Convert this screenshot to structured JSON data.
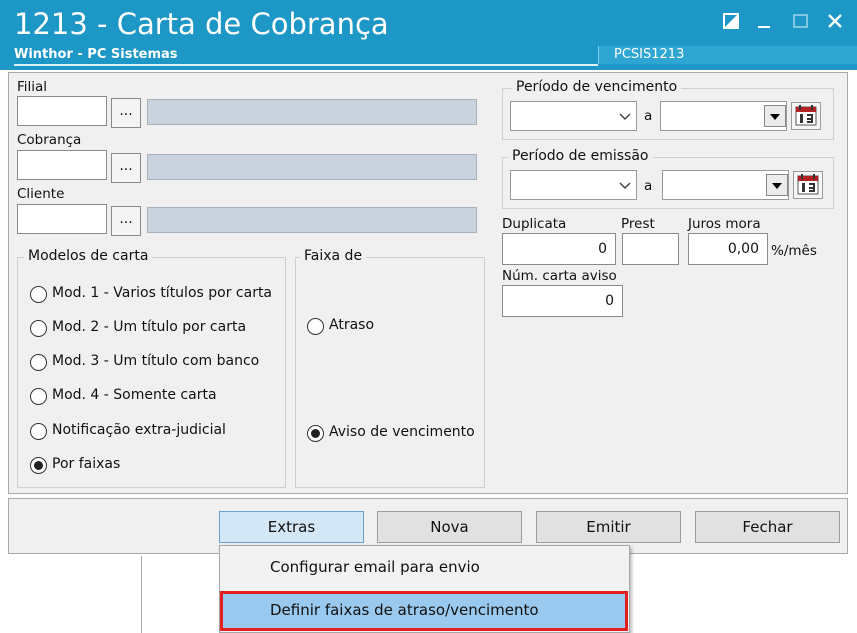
{
  "window": {
    "title": "1213 - Carta de Cobrança",
    "subtitle": "Winthor - PC Sistemas",
    "code": "PCSIS1213"
  },
  "filters": {
    "filial_label": "Filial",
    "cobranca_label": "Cobrança",
    "cliente_label": "Cliente",
    "lookup_button": "..."
  },
  "modelos": {
    "title": "Modelos de carta",
    "options": [
      {
        "label": "Mod. 1 - Varios títulos por carta",
        "selected": false
      },
      {
        "label": "Mod. 2 - Um título por carta",
        "selected": false
      },
      {
        "label": "Mod. 3 - Um título com banco",
        "selected": false
      },
      {
        "label": "Mod. 4 - Somente carta",
        "selected": false
      },
      {
        "label": "Notificação extra-judicial",
        "selected": false
      },
      {
        "label": "Por faixas",
        "selected": true
      }
    ]
  },
  "faixa": {
    "title": "Faixa de",
    "options": [
      {
        "label": "Atraso",
        "selected": false
      },
      {
        "label": "Aviso de vencimento",
        "selected": true
      }
    ]
  },
  "periodo_vencimento": {
    "title": "Período de vencimento",
    "separator": "a"
  },
  "periodo_emissao": {
    "title": "Período de emissão",
    "separator": "a"
  },
  "fields": {
    "duplicata_label": "Duplicata",
    "duplicata_value": "0",
    "prest_label": "Prest",
    "prest_value": "",
    "juros_label": "Juros mora",
    "juros_value": "0,00",
    "juros_unit": "%/mês",
    "num_carta_label": "Núm. carta aviso",
    "num_carta_value": "0"
  },
  "buttons": {
    "extras": "Extras",
    "nova": "Nova",
    "emitir": "Emitir",
    "fechar": "Fechar"
  },
  "menu": {
    "items": [
      "Configurar email para envio",
      "Definir faixas de atraso/vencimento"
    ],
    "highlighted": 1
  },
  "colors": {
    "titlebar": "#1c97c6",
    "readonly_field": "#c9d3de",
    "menu_highlight": "#99c9ee",
    "annotation_border": "#e41e1e"
  }
}
